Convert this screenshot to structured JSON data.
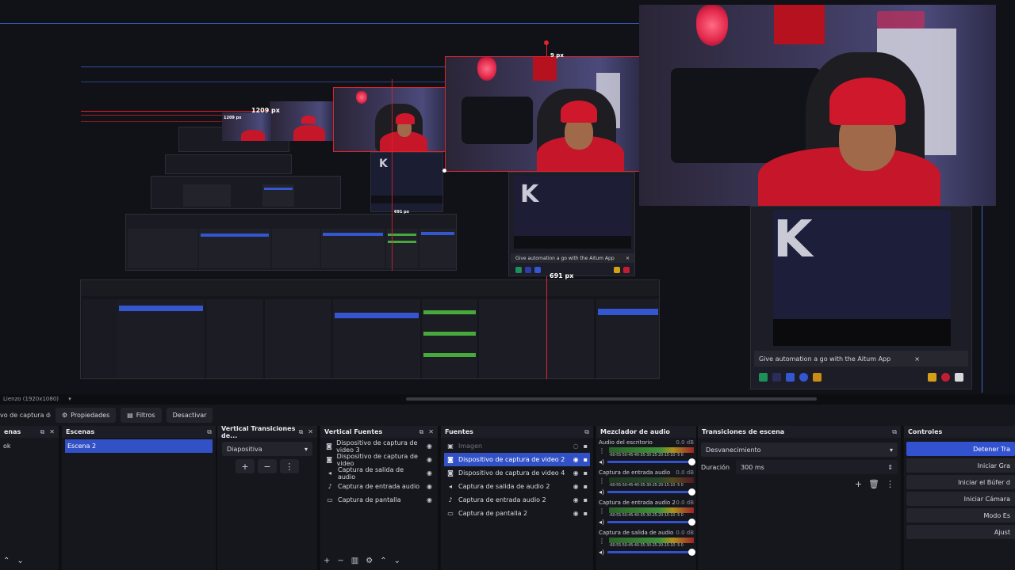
{
  "preview": {
    "dimension_labels": {
      "width_large": "1209 px",
      "width_small": "1209 px",
      "height_top": "9 px",
      "bottom_offset": "691 px",
      "bottom_offset_small": "691 px"
    },
    "notification_text": "Give automation a go with the Aitum App",
    "notification_text_small": "Give automation a go with the Aitum App",
    "notification_close": "×"
  },
  "status_bar": {
    "canvas_label": "Lienzo (1920x1080)"
  },
  "toolbar": {
    "source_name": "vo de captura de v",
    "properties_label": "Propiedades",
    "filters_label": "Filtros",
    "deactivate_label": "Desactivar"
  },
  "docks": {
    "left_partial_title": "enas",
    "left_partial_item": "ok",
    "scenes": {
      "title": "Escenas",
      "items": [
        "Escena 2"
      ]
    },
    "vertical_transitions": {
      "title": "Vertical Transiciones de...",
      "selected": "Diapositiva"
    },
    "vertical_sources": {
      "title": "Vertical Fuentes",
      "items": [
        "Dispositivo de captura de video 3",
        "Dispositivo de captura de video",
        "Captura de salida de audio",
        "Captura de entrada audio",
        "Captura de pantalla"
      ]
    },
    "sources": {
      "title": "Fuentes",
      "items": [
        "Imagen",
        "Dispositivo de captura de video 2",
        "Dispositivo de captura de video 4",
        "Captura de salida de audio 2",
        "Captura de entrada audio 2",
        "Captura de pantalla 2"
      ]
    },
    "audio_mixer": {
      "title": "Mezclador de audio",
      "channels": [
        {
          "name": "Audio del escritorio",
          "db": "0.0 dB"
        },
        {
          "name": "Captura de entrada audio",
          "db": "0.0 dB"
        },
        {
          "name": "Captura de entrada audio 2",
          "db": "0.0 dB"
        },
        {
          "name": "Captura de salida de audio",
          "db": "0.0 dB"
        }
      ],
      "scale": "-60-55-50-45-40-35-30-25-20-15-10 -5  0"
    },
    "scene_transitions": {
      "title": "Transiciones de escena",
      "selected": "Desvanecimiento",
      "duration_label": "Duración",
      "duration_value": "300 ms"
    },
    "controls": {
      "title": "Controles",
      "buttons": [
        "Detener Tra",
        "Iniciar Gra",
        "Iniciar el Búfer d",
        "Iniciar Cámara",
        "Modo Es",
        "Ajust"
      ]
    }
  }
}
